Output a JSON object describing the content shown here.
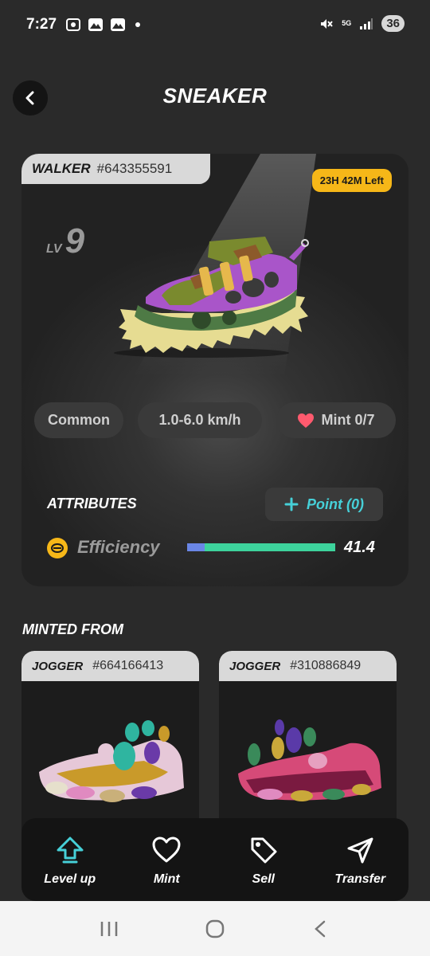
{
  "status_bar": {
    "time": "7:27",
    "network": "5G",
    "battery": "36"
  },
  "header": {
    "title": "SNEAKER"
  },
  "sneaker": {
    "type": "WALKER",
    "id": "#643355591",
    "time_left": "23H 42M Left",
    "level_label": "LV",
    "level": "9",
    "rarity": "Common",
    "speed": "1.0-6.0 km/h",
    "mint": "Mint 0/7"
  },
  "attributes": {
    "title": "ATTRIBUTES",
    "point_button": "Point (0)",
    "efficiency": {
      "label": "Efficiency",
      "value": "41.4",
      "bar_base_fraction": 0.12,
      "bar_fill_fraction": 0.88
    }
  },
  "minted_from": {
    "title": "MINTED FROM",
    "parents": [
      {
        "type": "JOGGER",
        "id": "#664166413"
      },
      {
        "type": "JOGGER",
        "id": "#310886849"
      }
    ]
  },
  "bottom_nav": {
    "items": [
      {
        "label": "Level up",
        "icon": "level-up-icon",
        "color": "#46d0d8"
      },
      {
        "label": "Mint",
        "icon": "heart-icon",
        "color": "#ffffff"
      },
      {
        "label": "Sell",
        "icon": "tag-icon",
        "color": "#ffffff"
      },
      {
        "label": "Transfer",
        "icon": "send-icon",
        "color": "#ffffff"
      }
    ]
  },
  "colors": {
    "accent_cyan": "#46d0d8",
    "badge_yellow": "#f6b718",
    "bar_green": "#3dd39c",
    "bar_blue": "#6a86e6"
  }
}
